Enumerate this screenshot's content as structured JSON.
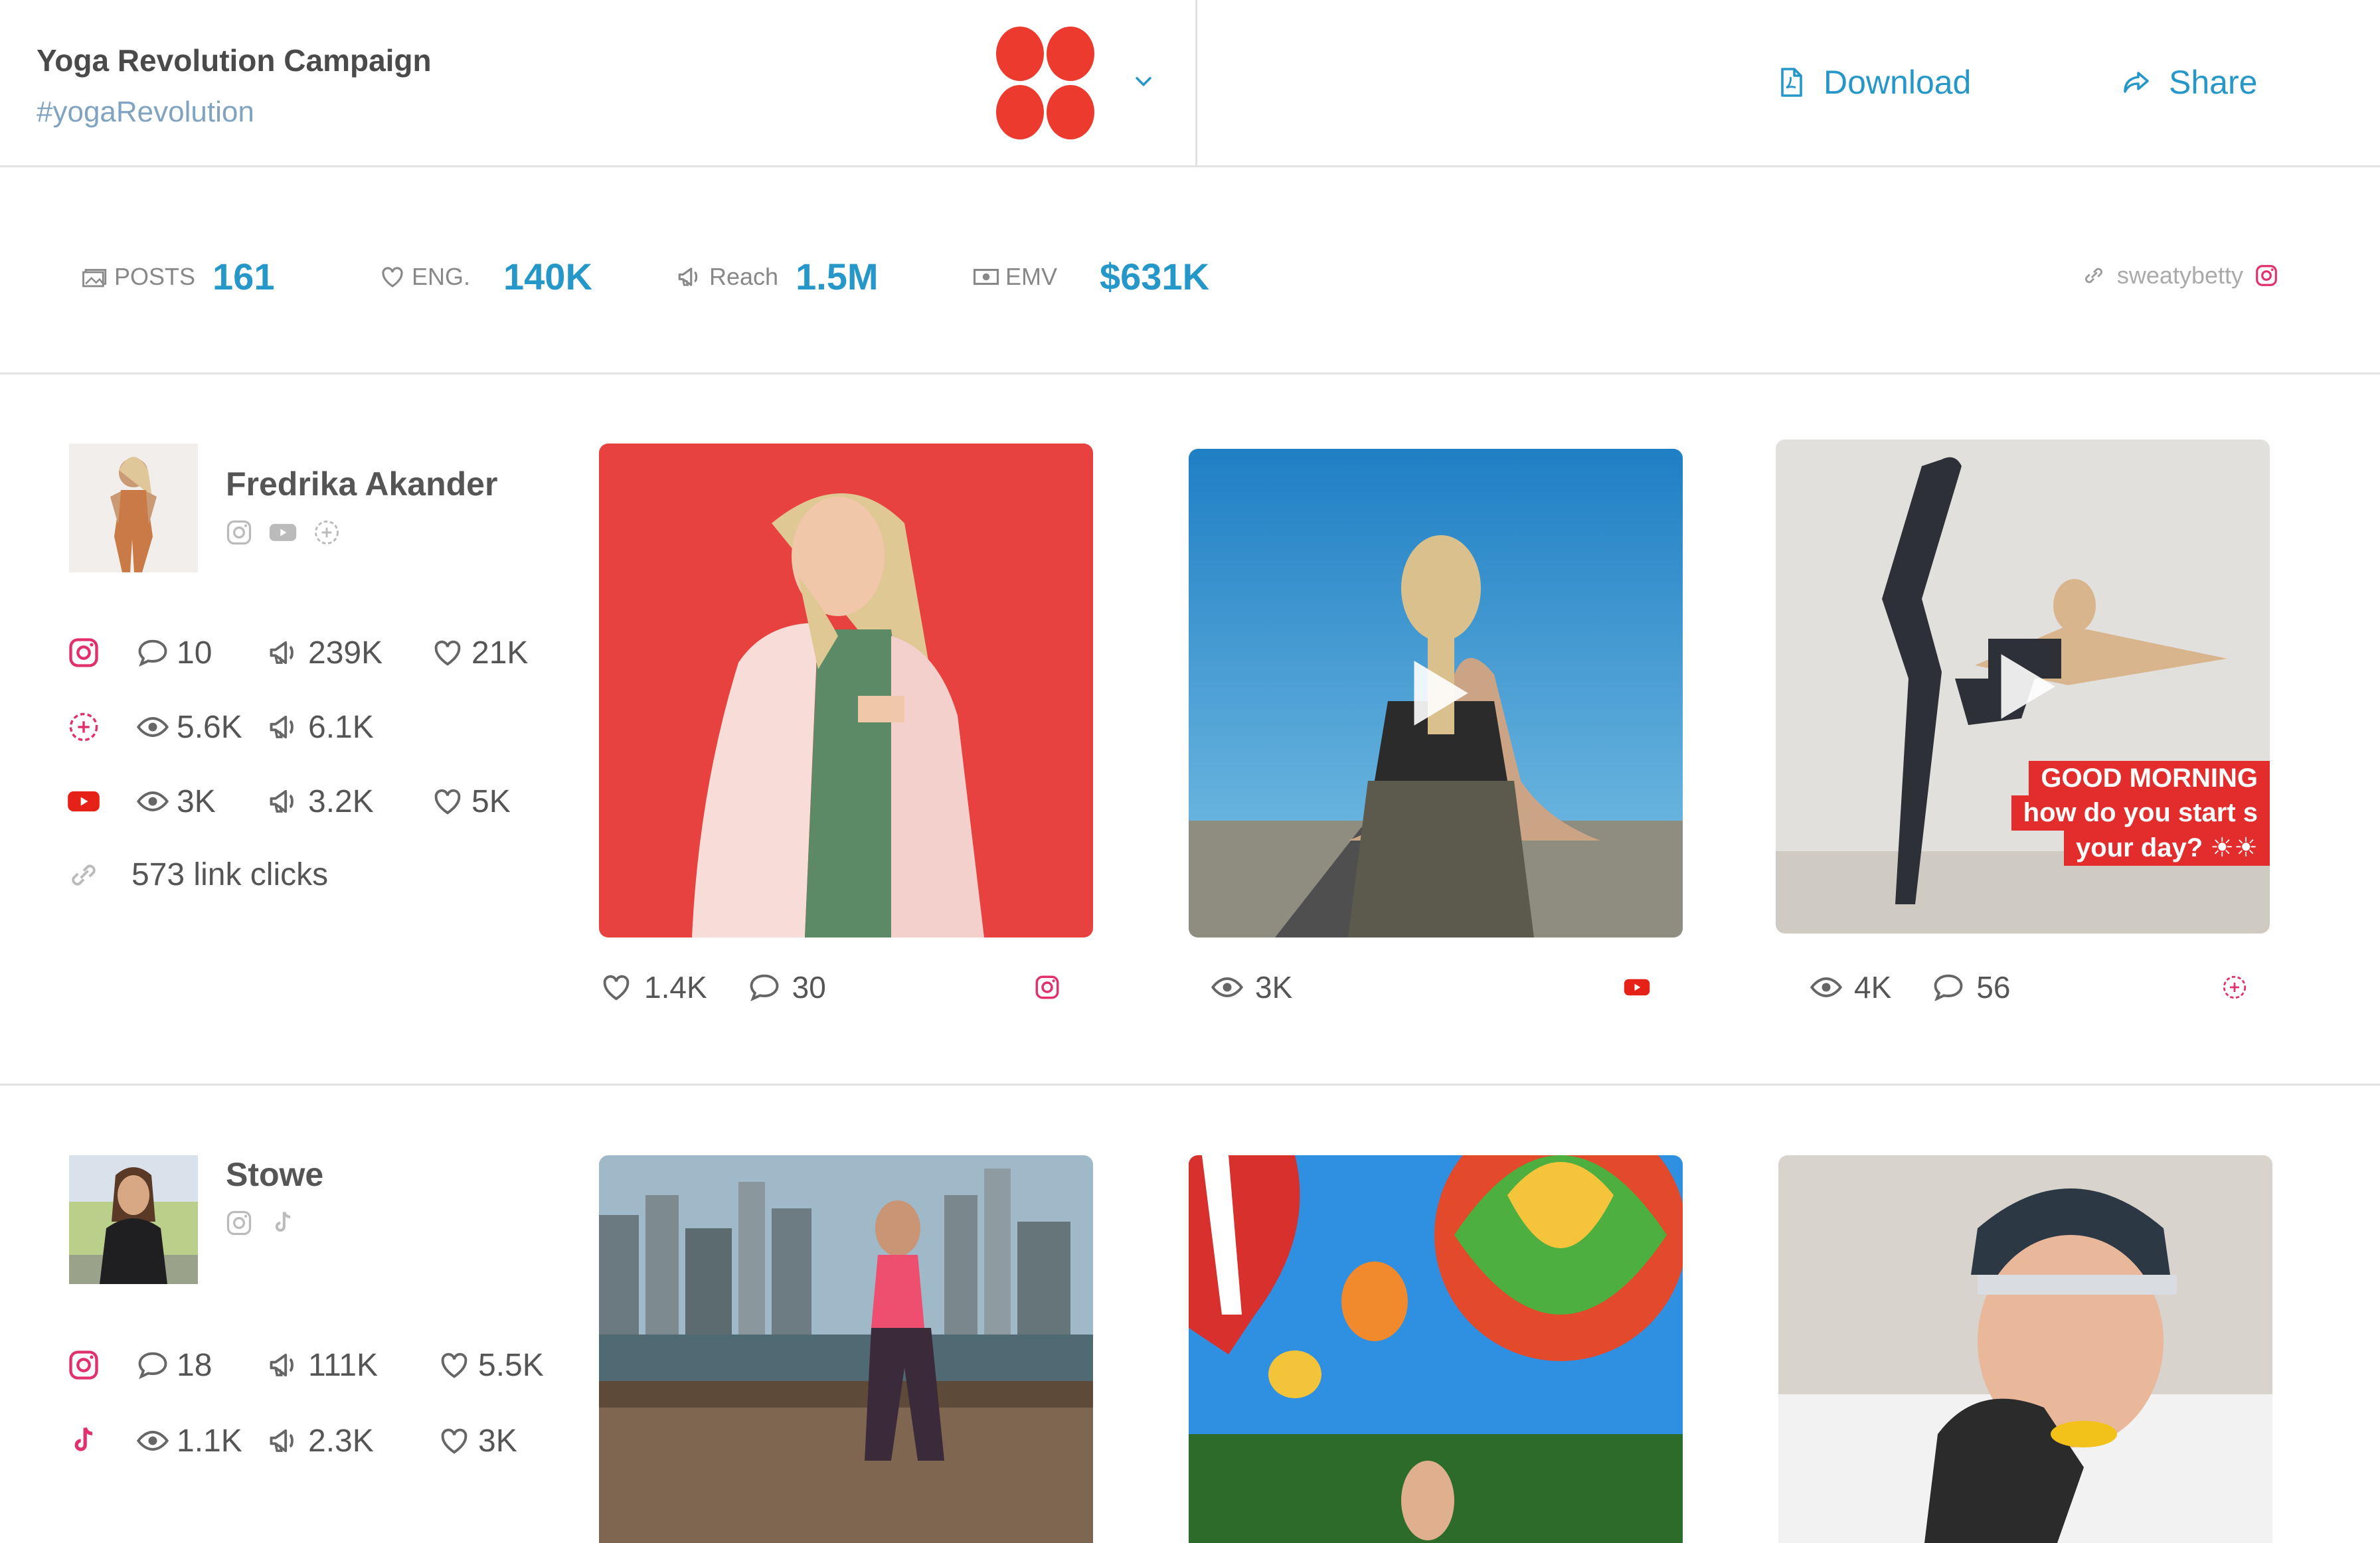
{
  "header": {
    "title": "Yoga Revolution Campaign",
    "hashtag": "#yogaRevolution",
    "download_label": "Download",
    "share_label": "Share"
  },
  "stats": [
    {
      "label": "POSTS",
      "value": "161",
      "icon": "posts-icon"
    },
    {
      "label": "ENG.",
      "value": "140K",
      "icon": "heart-icon"
    },
    {
      "label": "Reach",
      "value": "1.5M",
      "icon": "megaphone-icon"
    },
    {
      "label": "EMV",
      "value": "$631K",
      "icon": "money-icon"
    }
  ],
  "brand": {
    "name": "sweatybetty"
  },
  "colors": {
    "accent": "#2697c9",
    "logo": "#ec3b2e",
    "instagram": "#e1306c",
    "youtube": "#e62117"
  },
  "influencers": [
    {
      "name": "Fredrika Akander",
      "rows": {
        "instagram": {
          "comments": "10",
          "reach": "239K",
          "likes": "21K"
        },
        "stories": {
          "views": "5.6K",
          "reach": "6.1K"
        },
        "youtube": {
          "views": "3K",
          "reach": "3.2K",
          "likes": "5K"
        }
      },
      "link_clicks": "573 link clicks",
      "posts": [
        {
          "likes": "1.4K",
          "comments": "30",
          "network": "instagram"
        },
        {
          "views": "3K",
          "network": "youtube"
        },
        {
          "views": "4K",
          "comments": "56",
          "network": "stories",
          "overlay": [
            "GOOD MORNING",
            "how do you start s",
            "your day? ☀☀"
          ]
        }
      ]
    },
    {
      "name": "Stowe",
      "rows": {
        "instagram": {
          "comments": "18",
          "reach": "111K",
          "likes": "5.5K"
        },
        "tiktok": {
          "views": "1.1K",
          "reach": "2.3K",
          "likes": "3K"
        }
      }
    }
  ]
}
